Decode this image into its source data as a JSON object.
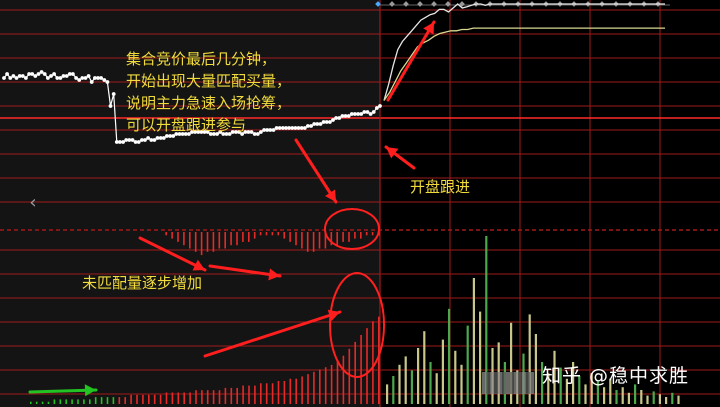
{
  "annotations": {
    "auction_text": [
      "集合竞价最后几分钟，",
      "开始出现大量匹配买量，",
      "说明主力急速入场抢筹，",
      "可以开盘跟进参与"
    ],
    "unmatched_text": "未匹配量逐步增加",
    "follow_text": "开盘跟进"
  },
  "nav": {
    "prev_icon": "‹"
  },
  "watermark": "知乎 @稳中求胜",
  "colors": {
    "background": "#000000",
    "auction_panel": "#141414",
    "grid_red": "#a11a1a",
    "price_line": "#ffffff",
    "avg_line": "#d8d890",
    "annotation_text": "#f2dc3c",
    "arrow_red": "#ff1e1e",
    "volume_red": "#e52a2a",
    "volume_green": "#22c322",
    "volume_tan": "#c9c68a",
    "circle_red": "#ff2020"
  },
  "chart_data": {
    "type": "line",
    "series": [
      {
        "values": [
          40,
          42,
          40,
          41,
          40,
          41,
          41,
          40,
          42,
          42,
          41,
          42,
          43,
          42,
          40,
          41,
          42,
          40,
          40,
          41,
          41,
          42,
          42,
          40,
          39,
          40,
          40,
          41,
          38,
          40,
          40,
          40,
          39,
          38,
          26,
          32,
          8,
          8,
          8,
          9,
          9,
          9,
          8,
          8,
          9,
          9,
          10,
          9,
          9,
          10,
          10,
          10,
          11,
          11,
          11,
          12,
          12,
          12,
          12,
          12,
          13,
          13,
          13,
          13,
          13,
          13,
          12,
          12,
          12,
          13,
          12,
          12,
          12,
          13,
          13,
          13,
          12,
          13,
          13,
          13,
          12,
          12,
          13,
          14,
          14,
          14,
          14,
          15,
          15,
          15,
          15,
          15,
          15,
          15,
          15,
          15,
          15,
          16,
          16,
          17,
          17,
          17,
          18,
          18,
          18,
          19,
          20,
          20,
          21,
          21,
          21,
          22,
          22,
          22,
          22,
          23,
          23,
          22,
          23,
          25,
          26
        ]
      },
      {
        "values": [
          28,
          40,
          54,
          66,
          72,
          76,
          80,
          84,
          88,
          90,
          92,
          93,
          96,
          96,
          94,
          97,
          100,
          97,
          98,
          99,
          100,
          100,
          99,
          100
        ]
      },
      {
        "values": [
          28,
          34,
          42,
          50,
          56,
          62,
          68,
          71,
          73,
          76,
          78,
          79,
          80,
          80,
          81,
          81,
          82,
          82,
          82,
          82
        ]
      }
    ],
    "volume": {
      "auction": [
        1,
        1,
        1,
        1,
        2,
        2,
        2,
        2,
        2,
        2,
        2,
        3,
        3,
        3,
        3,
        3,
        3,
        4,
        4,
        4,
        4,
        4,
        4,
        5,
        5,
        5,
        5,
        5,
        6,
        6,
        6,
        6,
        6,
        7,
        7,
        7,
        8,
        8,
        8,
        9,
        9,
        9,
        10,
        10,
        11,
        11,
        12,
        13,
        14,
        15,
        16,
        17,
        19,
        21,
        24,
        27,
        30,
        33,
        36,
        38
      ],
      "unmatched": [
        0,
        0,
        0,
        0,
        0,
        0,
        1,
        2,
        3,
        4,
        5,
        6,
        7,
        6,
        6,
        5,
        5,
        4,
        4,
        3,
        3,
        2,
        1,
        1,
        1,
        1,
        2,
        3,
        4,
        5,
        6,
        6,
        5,
        5,
        4,
        4,
        3,
        3,
        2,
        2,
        1,
        1,
        1,
        1,
        1,
        1,
        1,
        1,
        1,
        1,
        1,
        1,
        1,
        1,
        1,
        1,
        1,
        1,
        1,
        1
      ],
      "open": [
        14,
        20,
        28,
        34,
        24,
        40,
        52,
        30,
        22,
        46,
        68,
        38,
        28,
        56,
        90,
        66,
        120,
        40,
        44,
        30,
        58,
        24,
        36,
        64,
        50,
        30,
        22,
        38,
        26,
        18,
        30,
        20,
        14,
        22,
        16,
        12,
        18,
        10,
        12,
        8,
        14,
        10,
        6,
        9,
        7,
        5,
        8,
        6
      ]
    }
  }
}
